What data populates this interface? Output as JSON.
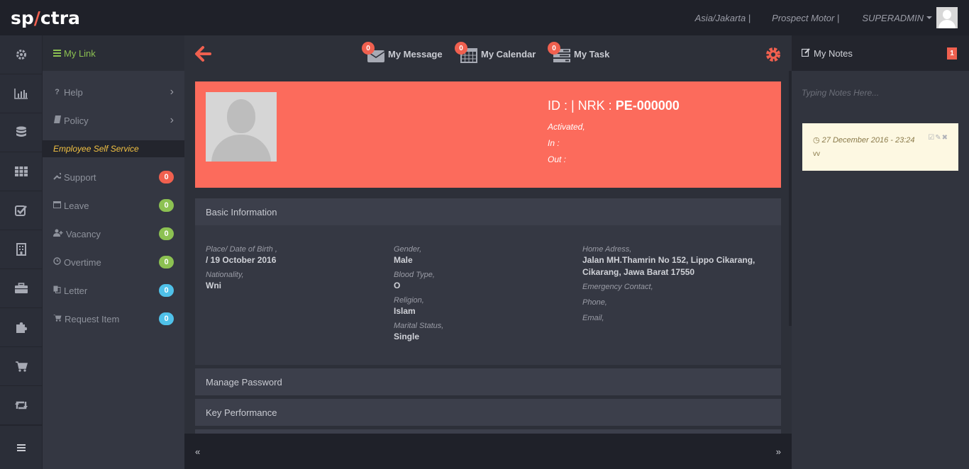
{
  "topbar": {
    "logo": {
      "prefix": "sp",
      "mark": "/",
      "suffix": "ctra"
    },
    "timezone": "Asia/Jakarta |",
    "company": "Prospect Motor |",
    "user": "SUPERADMIN"
  },
  "rail": [
    "gear-icon",
    "bar-chart-icon",
    "database-icon",
    "grid-icon",
    "checkbox-icon",
    "building-icon",
    "briefcase-icon",
    "puzzle-icon",
    "cart-icon",
    "retweet-icon",
    "menu-icon"
  ],
  "sidebar": {
    "title": "My Link",
    "links": [
      {
        "label": "Help",
        "icon": "question-icon"
      },
      {
        "label": "Policy",
        "icon": "book-icon"
      }
    ],
    "section": "Employee Self Service",
    "items": [
      {
        "label": "Support",
        "icon": "wrench-icon",
        "count": "0",
        "color": "#f0604f"
      },
      {
        "label": "Leave",
        "icon": "calendar-icon",
        "count": "0",
        "color": "#8cc152"
      },
      {
        "label": "Vacancy",
        "icon": "user-plus-icon",
        "count": "0",
        "color": "#8cc152"
      },
      {
        "label": "Overtime",
        "icon": "clock-icon",
        "count": "0",
        "color": "#8cc152"
      },
      {
        "label": "Letter",
        "icon": "copy-icon",
        "count": "0",
        "color": "#4fc1e9"
      },
      {
        "label": "Request Item",
        "icon": "cart-icon",
        "count": "0",
        "color": "#4fc1e9"
      }
    ]
  },
  "quicklinks": [
    {
      "label": "My Message",
      "count": "0",
      "icon": "envelope-icon"
    },
    {
      "label": "My Calendar",
      "count": "0",
      "icon": "calendar-icon"
    },
    {
      "label": "My Task",
      "count": "0",
      "icon": "tasks-icon"
    }
  ],
  "profile": {
    "id_prefix": "ID : | NRK :",
    "nrk": "PE-000000",
    "status": "Activated,",
    "in": "In :",
    "out": "Out :"
  },
  "basic": {
    "title": "Basic Information",
    "col1": [
      {
        "label": "Place/ Date of Birth ,",
        "value": "/ 19 October 2016"
      },
      {
        "label": "Nationality,",
        "value": "Wni"
      }
    ],
    "col2": [
      {
        "label": "Gender,",
        "value": "Male"
      },
      {
        "label": "Blood Type,",
        "value": "O"
      },
      {
        "label": "Religion,",
        "value": "Islam"
      },
      {
        "label": "Marital Status,",
        "value": "Single"
      }
    ],
    "col3": {
      "address_label": "Home Adress,",
      "address": "Jalan MH.Thamrin No 152, Lippo Cikarang, Cikarang, Jawa Barat 17550",
      "emergency_label": "Emergency Contact,",
      "phone_label": "Phone,",
      "email_label": "Email,"
    }
  },
  "panels": {
    "password": "Manage Password",
    "kpi": "Key Performance"
  },
  "pager": {
    "prev": "«",
    "next": "»"
  },
  "notes": {
    "title": "My Notes",
    "count": "1",
    "placeholder": "Typing Notes Here...",
    "items": [
      {
        "date": "27 December 2016 - 23:24",
        "text": "vv"
      }
    ]
  },
  "colors": {
    "accent": "#f0604f",
    "profile_bg": "#fc6b5c",
    "link_green": "#8cc152",
    "section_yellow": "#f3c243"
  }
}
